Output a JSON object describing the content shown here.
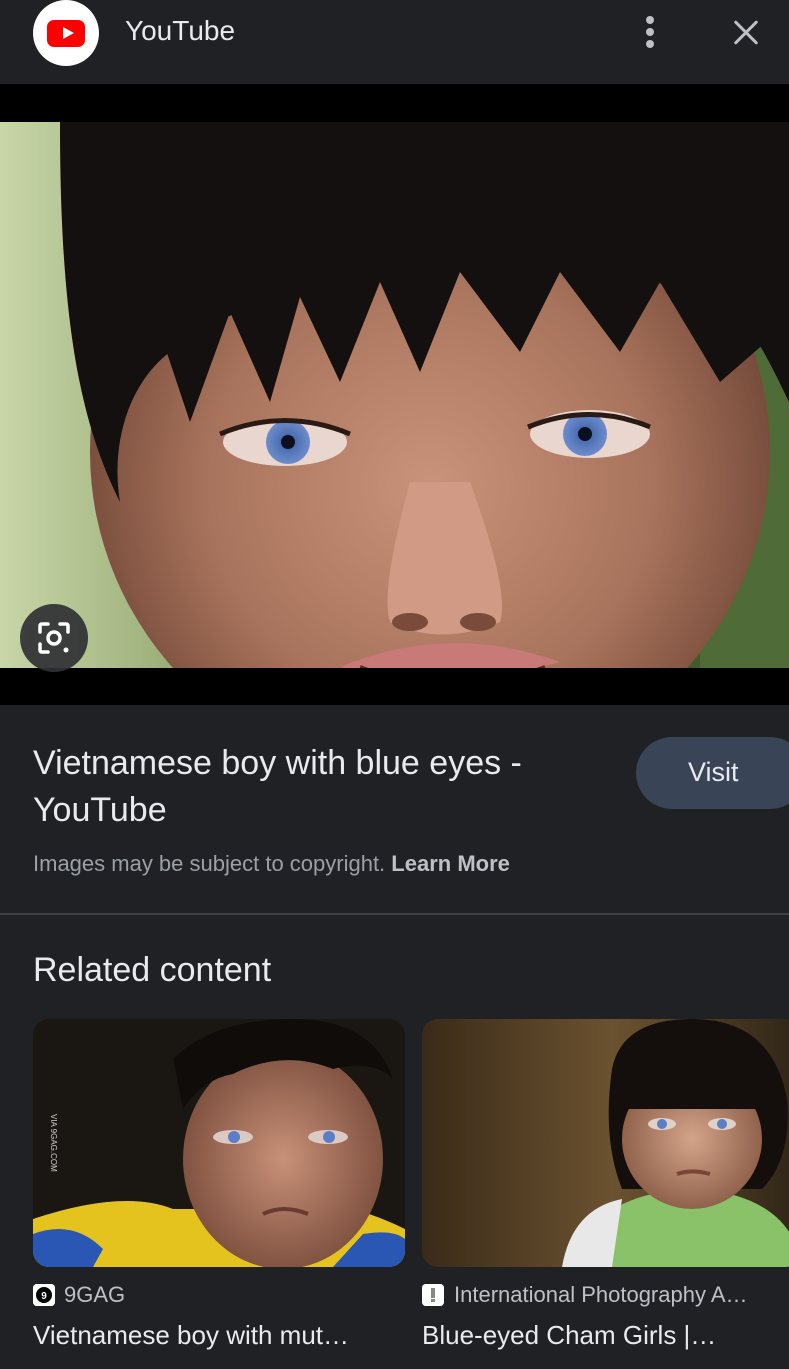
{
  "header": {
    "site_name": "YouTube"
  },
  "result": {
    "title": "Vietnamese boy with blue eyes - YouTube",
    "visit_label": "Visit",
    "copyright_text": "Images may be subject to copyright.",
    "learn_more_label": "Learn More"
  },
  "related": {
    "heading": "Related content",
    "items": [
      {
        "source": "9GAG",
        "title": "Vietnamese boy with mut…"
      },
      {
        "source": "International Photography A…",
        "title": "Blue-eyed Cham Girls |…"
      }
    ]
  },
  "colors": {
    "background": "#202124",
    "visit_button": "#394457",
    "youtube_red": "#ff0000"
  }
}
